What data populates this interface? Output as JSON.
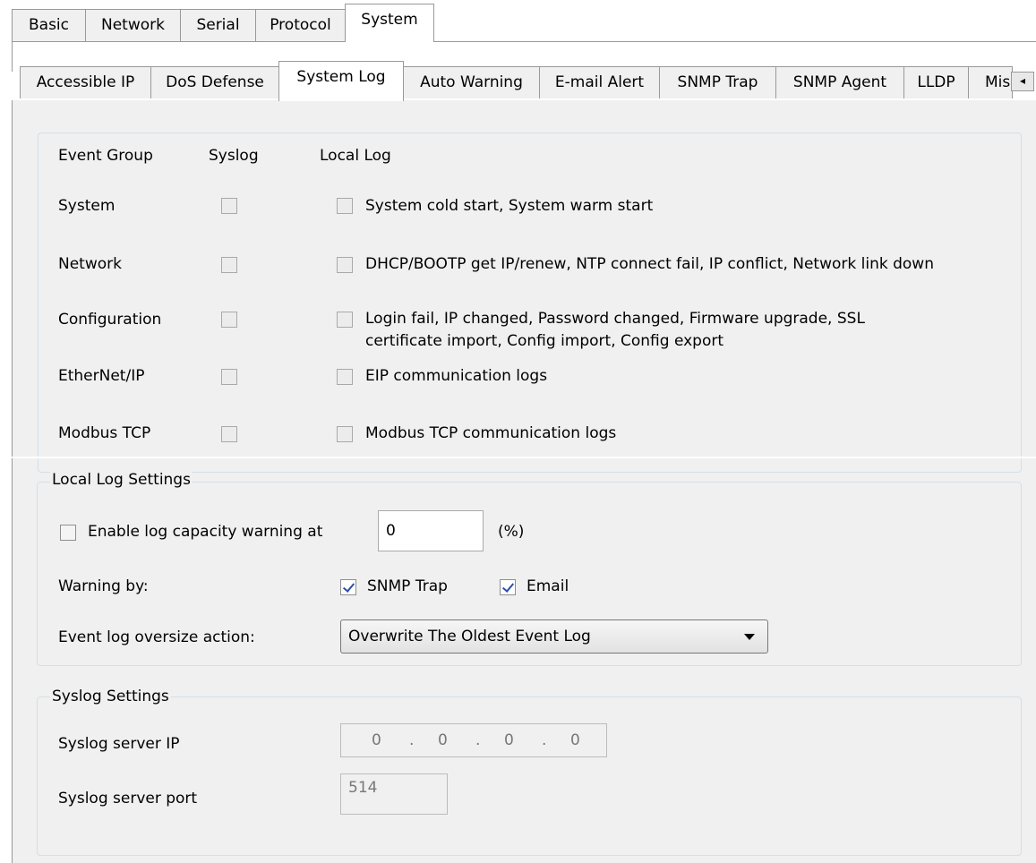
{
  "main_tabs": [
    "Basic",
    "Network",
    "Serial",
    "Protocol",
    "System"
  ],
  "sub_tabs": [
    "Accessible IP",
    "DoS Defense",
    "System Log",
    "Auto Warning",
    "E-mail Alert",
    "SNMP Trap",
    "SNMP Agent",
    "LLDP",
    "Mis"
  ],
  "scroll_left_glyph": "◂",
  "event_table": {
    "headers": {
      "group": "Event Group",
      "syslog": "Syslog",
      "local": "Local Log"
    },
    "rows": [
      {
        "group": "System",
        "syslog": false,
        "local": false,
        "desc": "System cold start, System warm start",
        "desc2": ""
      },
      {
        "group": "Network",
        "syslog": false,
        "local": false,
        "desc": "DHCP/BOOTP get IP/renew, NTP connect fail, IP conflict, Network link down",
        "desc2": ""
      },
      {
        "group": "Configuration",
        "syslog": false,
        "local": false,
        "desc": "Login fail, IP changed, Password changed, Firmware upgrade, SSL",
        "desc2": "certificate import, Config import, Config export"
      },
      {
        "group": "EtherNet/IP",
        "syslog": false,
        "local": false,
        "desc": "EIP communication logs",
        "desc2": ""
      },
      {
        "group": "Modbus TCP",
        "syslog": false,
        "local": false,
        "desc": "Modbus TCP communication logs",
        "desc2": ""
      }
    ]
  },
  "local_log": {
    "legend": "Local Log Settings",
    "capacity_label": "Enable log capacity warning at",
    "capacity_value": "0",
    "capacity_unit": "(%)",
    "warning_by_label": "Warning by:",
    "snmp_trap_label": "SNMP Trap",
    "email_label": "Email",
    "oversize_label": "Event log oversize action:",
    "oversize_value": "Overwrite The Oldest Event Log"
  },
  "syslog": {
    "legend": "Syslog Settings",
    "server_ip_label": "Syslog server IP",
    "ip_parts": [
      "0",
      "0",
      "0",
      "0"
    ],
    "server_port_label": "Syslog server port",
    "port_value": "514"
  }
}
